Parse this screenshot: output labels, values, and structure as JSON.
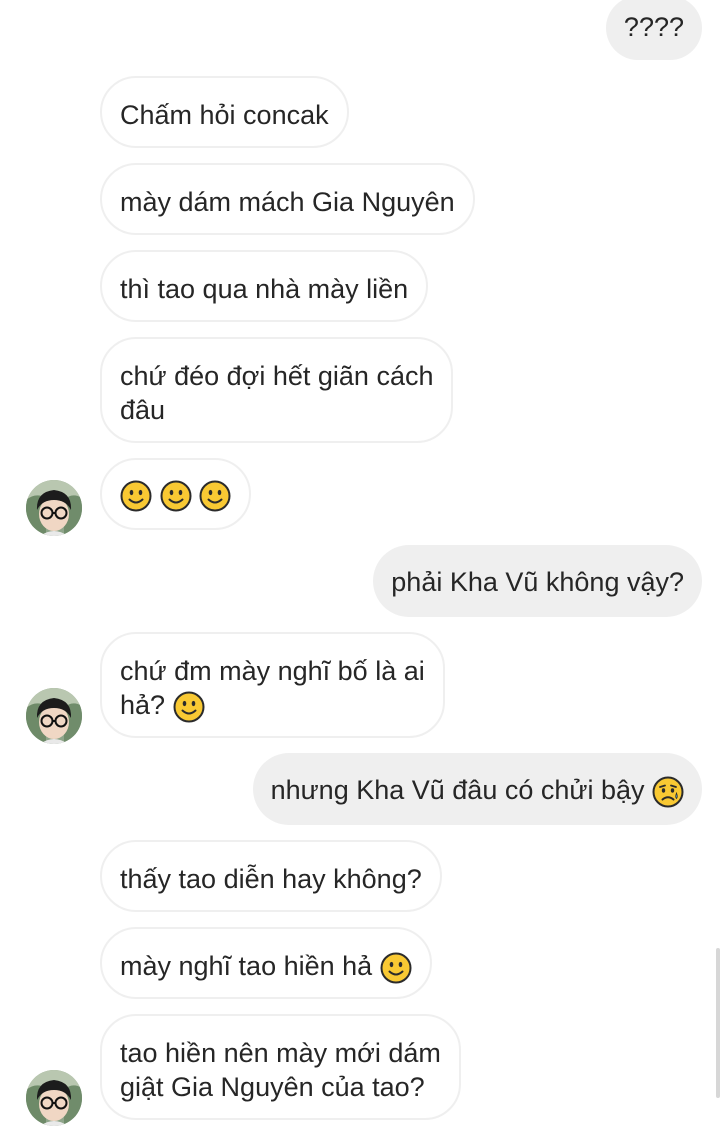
{
  "thread": {
    "messages": [
      {
        "dir": "out",
        "text": "????"
      },
      {
        "dir": "in",
        "text": "Chấm hỏi concak"
      },
      {
        "dir": "in",
        "text": "mày dám mách Gia Nguyên"
      },
      {
        "dir": "in",
        "text": "thì tao qua nhà mày liền"
      },
      {
        "dir": "in",
        "lines": [
          "chứ đéo đợi hết giãn cách",
          "đâu"
        ]
      },
      {
        "dir": "in",
        "emoji": [
          "slightly-smiling-face",
          "slightly-smiling-face",
          "slightly-smiling-face"
        ]
      },
      {
        "dir": "out",
        "text": "phải Kha Vũ không vậy?"
      },
      {
        "dir": "in",
        "lines": [
          "chứ đm mày nghĩ bố là ai",
          "hả?"
        ],
        "trailing_emoji": "slightly-smiling-face"
      },
      {
        "dir": "out",
        "text": "nhưng Kha Vũ đâu có chửi bậy",
        "trailing_emoji": "sad-but-relieved-face"
      },
      {
        "dir": "in",
        "text": "thấy tao diễn hay không?"
      },
      {
        "dir": "in",
        "text": "mày nghĩ tao hiền hả",
        "trailing_emoji": "slightly-smiling-face"
      },
      {
        "dir": "in",
        "lines": [
          "tao hiền nên mày mới dám",
          "giật Gia Nguyên của tao?"
        ]
      }
    ]
  },
  "colors": {
    "outgoing_bubble": "#efefef",
    "incoming_border": "#efefef",
    "text": "#262626",
    "emoji_yellow": "#f9c933",
    "emoji_outline": "#2b2b2b"
  }
}
